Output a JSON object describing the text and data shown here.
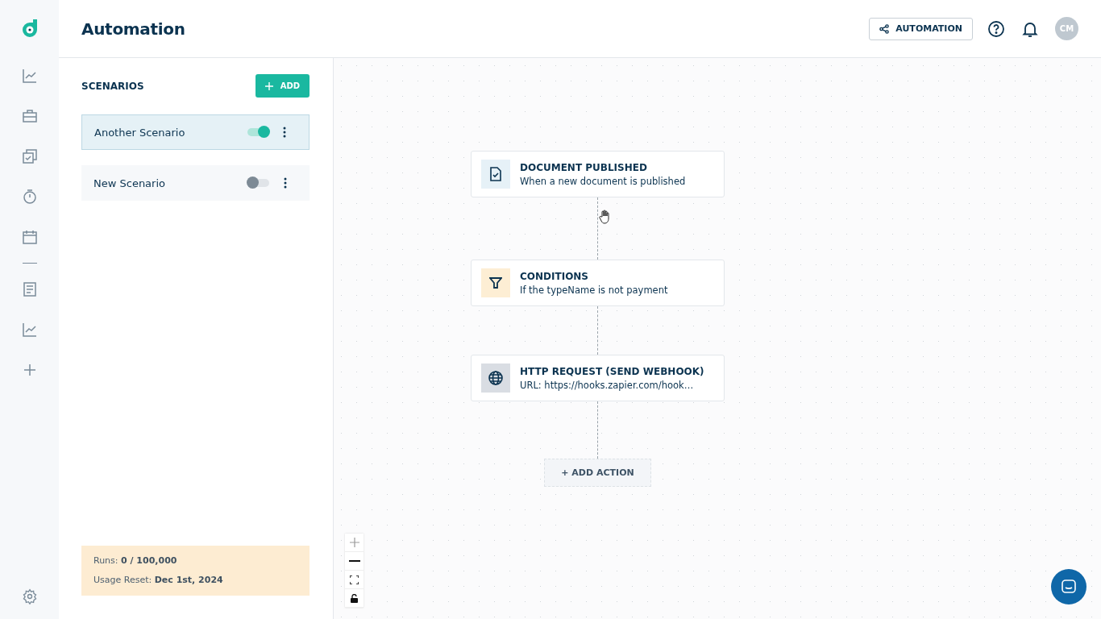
{
  "header": {
    "title": "Automation",
    "mode_button": "AUTOMATION",
    "avatar": "CM"
  },
  "sidebar": {
    "items": [
      {
        "kind": "chart"
      },
      {
        "kind": "briefcase"
      },
      {
        "kind": "tasks"
      },
      {
        "kind": "timer"
      },
      {
        "kind": "calendar"
      },
      {
        "kind": "divider"
      },
      {
        "kind": "document"
      },
      {
        "kind": "chart"
      },
      {
        "kind": "plus"
      }
    ]
  },
  "scenarios": {
    "title": "SCENARIOS",
    "add_button": "ADD",
    "items": [
      {
        "name": "Another Scenario",
        "selected": true,
        "on": true
      },
      {
        "name": "New Scenario",
        "selected": false,
        "on": false
      }
    ]
  },
  "usage": {
    "runs_label": "Runs:",
    "runs": "0 / 100,000",
    "reset_label": "Usage Reset:",
    "reset": "Dec 1st, 2024"
  },
  "flow": {
    "nodes": [
      {
        "kind": "trigger",
        "title": "DOCUMENT PUBLISHED",
        "subtitle": "When a new document is published"
      },
      {
        "kind": "condition",
        "title": "CONDITIONS",
        "subtitle": "If the typeName is not payment"
      },
      {
        "kind": "webhook",
        "title": "HTTP REQUEST (SEND WEBHOOK)",
        "subtitle": "URL: https://hooks.zapier.com/hook…"
      }
    ],
    "add_action": "+ ADD ACTION"
  }
}
